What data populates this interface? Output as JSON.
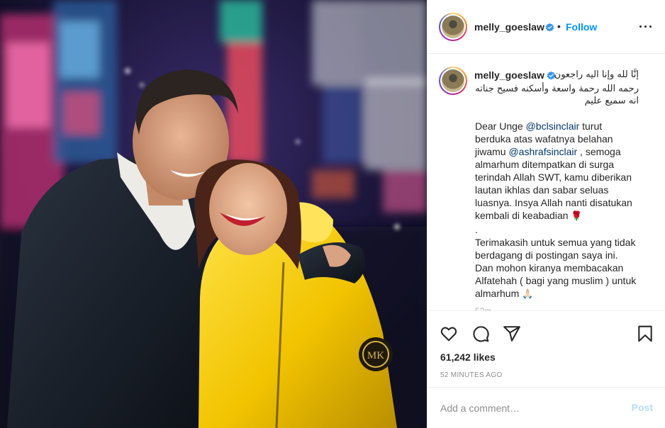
{
  "post": {
    "username": "melly_goeslaw",
    "follow_label": "Follow",
    "separator": "•",
    "verified_icon": "verified-badge-icon",
    "more_icon": "more-options-icon"
  },
  "caption": {
    "username": "melly_goeslaw",
    "arabic_line1": "إنَّا لله وإنا اليه راجعون",
    "arabic_line2": "رحمه الله رحمة واسعة وأسكنه فسيح جناته",
    "arabic_line3": "انه سميع عليم",
    "p1": "Dear Unge ",
    "mention1": "@bclsinclair",
    "p1b": " turut",
    "p2": "berduka atas wafatnya belahan",
    "p3a": "jiwamu ",
    "mention2": "@ashrafsinclair",
    "p3b": " , semoga",
    "p4": "almarhum ditempatkan di surga",
    "p5": "terindah Allah SWT, kamu diberikan",
    "p6": "lautan ikhlas dan sabar seluas",
    "p7": "luasnya. Insya Allah nanti disatukan",
    "p8": "kembali di keabadian ",
    "rose": "🌹",
    "p9": ".",
    "p10": "Terimakasih untuk semua yang tidak",
    "p11": "berdagang di postingan saya ini.",
    "p12": "Dan mohon kiranya membacakan",
    "p13": "Alfatehah ( bagi yang muslim ) untuk",
    "p14": "almarhum ",
    "pray": "🙏🏻",
    "time_short": "52m"
  },
  "actions": {
    "like_icon": "heart-icon",
    "comment_icon": "comment-icon",
    "share_icon": "share-icon",
    "save_icon": "bookmark-icon",
    "likes": "61,242 likes",
    "ago": "52 MINUTES AGO"
  },
  "comment": {
    "placeholder": "Add a comment…",
    "post_label": "Post"
  },
  "colors": {
    "link": "#0095f6",
    "mention": "#00376b",
    "post_disabled": "#b2dffc",
    "jacket": "#f2c400"
  }
}
